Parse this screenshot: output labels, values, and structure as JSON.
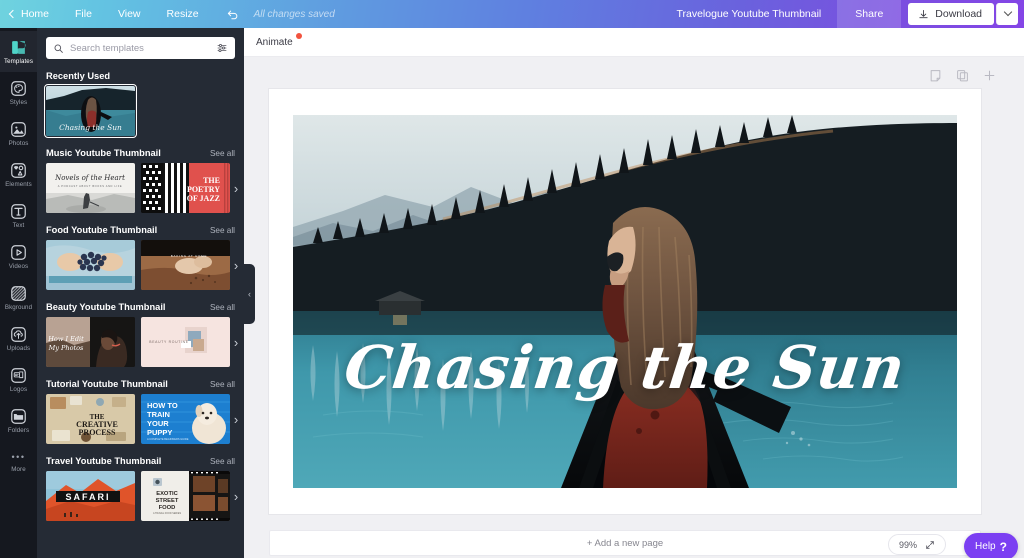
{
  "topbar": {
    "home_label": "Home",
    "menus": [
      "File",
      "View",
      "Resize"
    ],
    "undo_icon": "undo-arrow-icon",
    "saved_status": "All changes saved",
    "doc_title": "Travelogue Youtube Thumbnail",
    "share_label": "Share",
    "download_label": "Download",
    "download_icon": "download-icon",
    "download_caret_icon": "chevron-down-icon",
    "gradient_start": "#6fd3df",
    "gradient_end": "#8445e6"
  },
  "rail": {
    "items": [
      {
        "label": "Templates",
        "icon": "templates-icon",
        "active": true
      },
      {
        "label": "Styles",
        "icon": "palette-icon",
        "active": false
      },
      {
        "label": "Photos",
        "icon": "photo-icon",
        "active": false
      },
      {
        "label": "Elements",
        "icon": "elements-icon",
        "active": false
      },
      {
        "label": "Text",
        "icon": "text-icon",
        "active": false
      },
      {
        "label": "Videos",
        "icon": "video-play-icon",
        "active": false
      },
      {
        "label": "Bkground",
        "icon": "background-pattern-icon",
        "active": false
      },
      {
        "label": "Uploads",
        "icon": "upload-cloud-icon",
        "active": false
      },
      {
        "label": "Logos",
        "icon": "logos-icon",
        "active": false
      },
      {
        "label": "Folders",
        "icon": "folder-icon",
        "active": false
      },
      {
        "label": "More",
        "icon": "ellipsis-icon",
        "active": false
      }
    ],
    "active_color": "#22262f",
    "bg_color": "#15181f"
  },
  "panel": {
    "search_placeholder": "Search templates",
    "search_value": "",
    "search_icon": "magnifier-icon",
    "filter_icon": "filter-sliders-icon",
    "see_all_label": "See all",
    "next_arrow_icon": "chevron-right-icon",
    "collapse_icon": "chevron-left-icon",
    "sections": [
      {
        "title": "Recently Used",
        "has_see_all": false,
        "has_arrow": false,
        "templates": [
          {
            "name": "chasing-the-sun",
            "caption": "Chasing the Sun",
            "selected": true
          }
        ]
      },
      {
        "title": "Music Youtube Thumbnail",
        "has_see_all": true,
        "has_arrow": true,
        "templates": [
          {
            "name": "novels-of-the-heart",
            "caption": "Novels of the Heart",
            "selected": false
          },
          {
            "name": "the-poetry-of-jazz",
            "caption": "THE POETRY OF JAZZ",
            "selected": false
          }
        ]
      },
      {
        "title": "Food Youtube Thumbnail",
        "has_see_all": true,
        "has_arrow": true,
        "templates": [
          {
            "name": "blueberries",
            "caption": "",
            "selected": false
          },
          {
            "name": "baking-hands",
            "caption": "",
            "selected": false
          }
        ]
      },
      {
        "title": "Beauty Youtube Thumbnail",
        "has_see_all": true,
        "has_arrow": true,
        "templates": [
          {
            "name": "how-i-edit-my-photos",
            "caption": "How I Edit My Photos",
            "selected": false
          },
          {
            "name": "beauty-minimal",
            "caption": "",
            "selected": false
          }
        ]
      },
      {
        "title": "Tutorial Youtube Thumbnail",
        "has_see_all": true,
        "has_arrow": true,
        "templates": [
          {
            "name": "the-creative-process",
            "caption": "THE CREATIVE PROCESS",
            "selected": false
          },
          {
            "name": "how-to-train-your-puppy",
            "caption": "HOW TO TRAIN YOUR PUPPY",
            "selected": false
          }
        ]
      },
      {
        "title": "Travel Youtube Thumbnail",
        "has_see_all": true,
        "has_arrow": true,
        "templates": [
          {
            "name": "safari",
            "caption": "SAFARI",
            "selected": false
          },
          {
            "name": "exotic-street-food",
            "caption": "EXOTIC STREET FOOD",
            "selected": false
          }
        ]
      }
    ]
  },
  "editor": {
    "animate_label": "Animate",
    "animate_has_badge": true,
    "notes_icon": "notes-page-icon",
    "duplicate_icon": "duplicate-page-icon",
    "add_icon": "plus-icon",
    "artboard_title": "Chasing the Sun"
  },
  "bottombar": {
    "add_page_label": "+ Add a new page",
    "zoom_level": "99%",
    "expand_icon": "expand-arrows-icon",
    "help_label": "Help",
    "help_mark": "?",
    "help_color": "#7b3ff2"
  }
}
